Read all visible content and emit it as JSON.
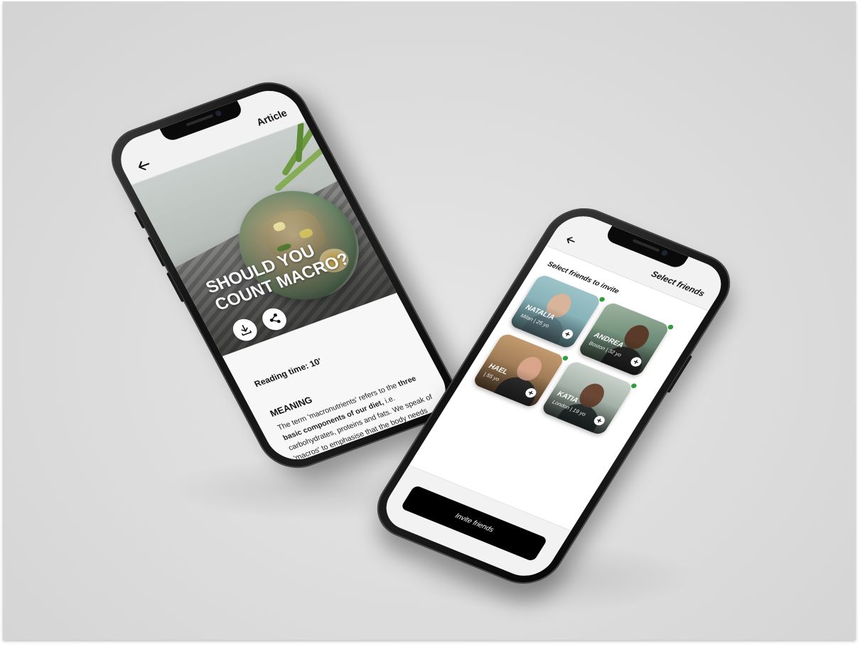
{
  "article_screen": {
    "appbar": {
      "back_icon": "arrow-left-icon",
      "title": "Article"
    },
    "hero": {
      "title_line1": "SHOULD YOU",
      "title_line2": "COUNT MACRO?",
      "actions": [
        {
          "icon": "download-icon"
        },
        {
          "icon": "share-icon"
        }
      ]
    },
    "reading_time": "Reading time: 10'",
    "section_title": "MEANING",
    "paragraph": {
      "part1": "The term 'macronutrients' refers to the ",
      "bold": "three basic components of our diet,",
      "part2": " i.e. carbohydrates, proteins and fats. We speak of 'macros' to emphasise that the body needs large quantities of these"
    }
  },
  "friends_screen": {
    "appbar": {
      "back_icon": "arrow-left-icon",
      "title": "Select friends"
    },
    "subtitle": "Select friends to invite",
    "friends": [
      {
        "name": "NATALIA",
        "meta": "Milan | 25 yo",
        "online": true
      },
      {
        "name": "ANDREA",
        "meta": "Boston | 32 yo",
        "online": true
      },
      {
        "name": "HAEL",
        "meta": "| 55 yo",
        "online": true
      },
      {
        "name": "KATIA",
        "meta": "London | 19 yo",
        "online": true
      }
    ],
    "add_icon": "plus-circle-icon",
    "invite_button": "Invite friends"
  },
  "colors": {
    "background": "#dcdcdc",
    "phone_body": "#111111",
    "online": "#2e9e3a",
    "primary_button": "#000000"
  }
}
